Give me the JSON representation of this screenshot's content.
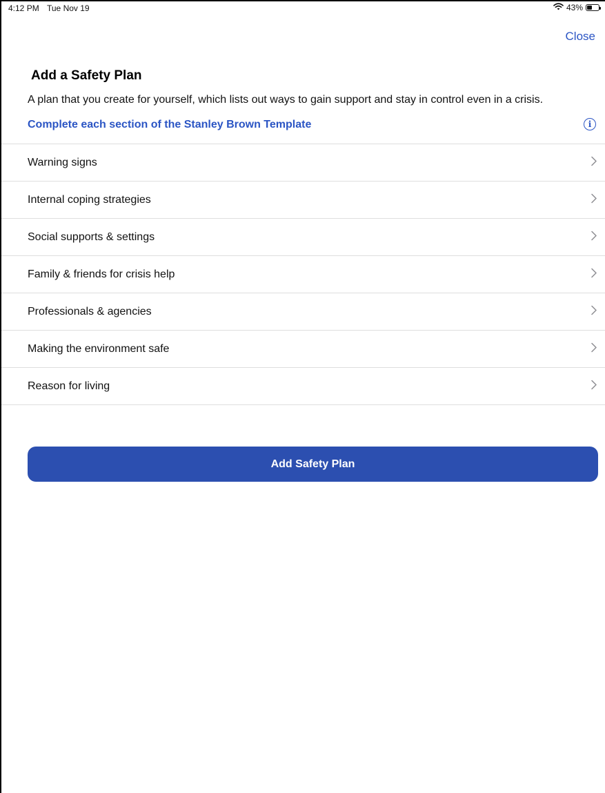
{
  "status_bar": {
    "time": "4:12 PM",
    "date": "Tue Nov 19",
    "battery_text": "43%",
    "battery_level": 0.43
  },
  "header": {
    "close_label": "Close"
  },
  "main": {
    "title": "Add a Safety Plan",
    "description": "A plan that you create for yourself, which lists out ways to gain support and stay in control even in a crisis.",
    "template_link": "Complete each section of the Stanley Brown Template"
  },
  "sections": [
    {
      "label": "Warning signs"
    },
    {
      "label": "Internal coping strategies"
    },
    {
      "label": "Social supports & settings"
    },
    {
      "label": "Family & friends for crisis help"
    },
    {
      "label": "Professionals & agencies"
    },
    {
      "label": "Making the environment safe"
    },
    {
      "label": "Reason for living"
    }
  ],
  "actions": {
    "add_label": "Add Safety Plan"
  },
  "colors": {
    "accent": "#2b55c4",
    "button_bg": "#2c4fb0",
    "divider": "#dedede"
  }
}
